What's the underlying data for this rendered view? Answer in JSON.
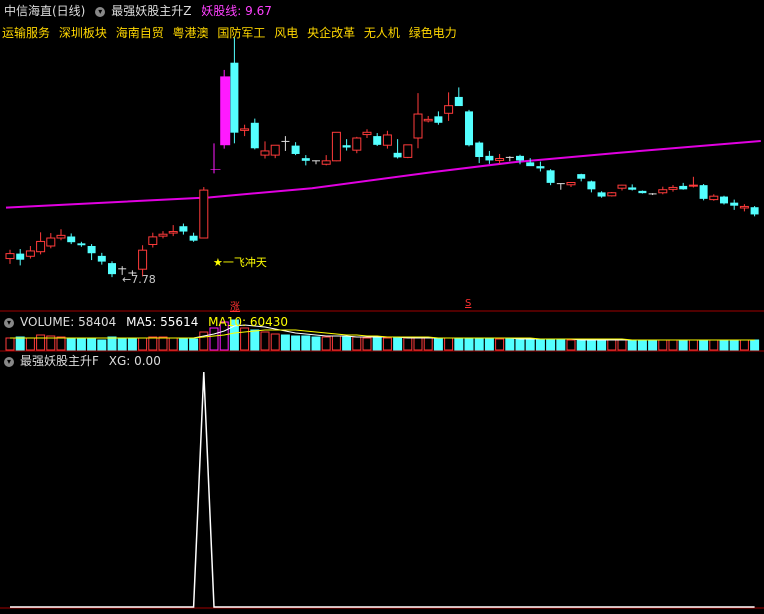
{
  "header": {
    "stock_title": "中信海直(日线)",
    "indicator_name": "最强妖股主升Z",
    "yaogu_label": "妖股线: 9.67"
  },
  "sector_tags": [
    "运输服务",
    "深圳板块",
    "海南自贸",
    "粤港澳",
    "国防军工",
    "风电",
    "央企改革",
    "无人机",
    "绿色电力"
  ],
  "annotations": {
    "low_price": "7.78",
    "signal_text": "一飞冲天",
    "signal_star": "★",
    "badge_zhang": "涨",
    "badge_s": "S"
  },
  "volume_panel": {
    "volume_label": "VOLUME: 58404",
    "ma5_label": "MA5: 55614",
    "ma10_label": "MA10: 60430"
  },
  "xg_panel": {
    "title": "最强妖股主升F",
    "xg_label": "XG: 0.00"
  },
  "colors": {
    "up": "#ff3b3b",
    "down": "#54ffff",
    "signal": "#ff1aff",
    "signal_base": "#ffff00",
    "ma_line": "#e100e1",
    "ma5": "#ffffff",
    "ma10": "#ffff00",
    "tags": "#ffd700"
  },
  "chart_data": {
    "type": "candlestick",
    "price_scale": "price in 0.5-yuan steps",
    "candles": [
      [
        8.49,
        8.62,
        8.72,
        8.35,
        "up"
      ],
      [
        8.62,
        8.46,
        8.74,
        8.31,
        "down"
      ],
      [
        8.55,
        8.69,
        8.82,
        8.49,
        "up"
      ],
      [
        8.67,
        8.94,
        9.18,
        8.6,
        "up"
      ],
      [
        8.82,
        9.03,
        9.16,
        8.76,
        "up"
      ],
      [
        9.03,
        9.1,
        9.26,
        8.97,
        "up"
      ],
      [
        9.07,
        8.92,
        9.15,
        8.87,
        "down"
      ],
      [
        8.89,
        8.84,
        8.93,
        8.8,
        "down"
      ],
      [
        8.82,
        8.63,
        8.87,
        8.45,
        "down"
      ],
      [
        8.56,
        8.41,
        8.64,
        8.33,
        "down"
      ],
      [
        8.37,
        8.08,
        8.42,
        8.0,
        "down"
      ],
      [
        8.22,
        8.22,
        8.29,
        8.06,
        "flat"
      ],
      [
        8.11,
        8.11,
        8.18,
        8.03,
        "flat"
      ],
      [
        8.21,
        8.71,
        8.84,
        8.02,
        "up"
      ],
      [
        8.86,
        9.06,
        9.17,
        8.78,
        "up"
      ],
      [
        9.08,
        9.13,
        9.21,
        9.02,
        "up"
      ],
      [
        9.16,
        9.2,
        9.37,
        9.08,
        "up"
      ],
      [
        9.34,
        9.2,
        9.41,
        9.12,
        "down"
      ],
      [
        9.09,
        8.96,
        9.17,
        8.93,
        "down"
      ],
      [
        9.03,
        10.29,
        10.37,
        9.02,
        "up"
      ],
      [
        10.84,
        10.84,
        11.52,
        10.73,
        "up"
      ],
      [
        11.47,
        13.28,
        13.45,
        11.38,
        "up"
      ],
      [
        13.64,
        11.8,
        14.31,
        11.52,
        "down"
      ],
      [
        11.9,
        11.86,
        12.01,
        11.71,
        "up"
      ],
      [
        12.06,
        11.39,
        12.17,
        11.36,
        "down"
      ],
      [
        11.21,
        11.32,
        11.57,
        11.12,
        "up"
      ],
      [
        11.21,
        11.47,
        11.47,
        11.13,
        "up"
      ],
      [
        11.57,
        11.57,
        11.71,
        11.32,
        "flat"
      ],
      [
        11.46,
        11.24,
        11.55,
        11.21,
        "down"
      ],
      [
        11.13,
        11.06,
        11.21,
        10.94,
        "down"
      ],
      [
        11.06,
        11.05,
        11.07,
        10.97,
        "flat"
      ],
      [
        10.97,
        11.06,
        11.21,
        10.94,
        "up"
      ],
      [
        11.06,
        11.81,
        11.81,
        11.05,
        "up"
      ],
      [
        11.47,
        11.41,
        11.63,
        11.33,
        "down"
      ],
      [
        11.34,
        11.66,
        11.69,
        11.26,
        "up"
      ],
      [
        11.75,
        11.81,
        11.89,
        11.66,
        "up"
      ],
      [
        11.71,
        11.48,
        11.79,
        11.45,
        "down"
      ],
      [
        11.47,
        11.74,
        11.85,
        11.38,
        "up"
      ],
      [
        11.27,
        11.15,
        11.63,
        11.12,
        "down"
      ],
      [
        11.15,
        11.48,
        11.48,
        11.13,
        "up"
      ],
      [
        11.66,
        12.29,
        12.84,
        11.39,
        "up"
      ],
      [
        12.11,
        12.15,
        12.24,
        12.07,
        "up"
      ],
      [
        12.23,
        12.06,
        12.36,
        12.01,
        "down"
      ],
      [
        12.31,
        12.51,
        12.86,
        12.11,
        "up"
      ],
      [
        12.74,
        12.5,
        12.99,
        12.52,
        "down"
      ],
      [
        12.36,
        11.47,
        12.4,
        11.44,
        "down"
      ],
      [
        11.54,
        11.16,
        11.57,
        11.0,
        "down"
      ],
      [
        11.19,
        11.07,
        11.32,
        10.98,
        "down"
      ],
      [
        11.07,
        11.12,
        11.24,
        10.97,
        "up"
      ],
      [
        11.15,
        11.12,
        11.18,
        11.05,
        "flat"
      ],
      [
        11.19,
        11.07,
        11.22,
        10.97,
        "down"
      ],
      [
        11.02,
        10.92,
        11.13,
        10.94,
        "down"
      ],
      [
        10.92,
        10.86,
        11.04,
        10.78,
        "down"
      ],
      [
        10.81,
        10.48,
        10.84,
        10.42,
        "down"
      ],
      [
        10.46,
        10.45,
        10.47,
        10.3,
        "flat"
      ],
      [
        10.43,
        10.49,
        10.49,
        10.37,
        "up"
      ],
      [
        10.71,
        10.59,
        10.72,
        10.52,
        "down"
      ],
      [
        10.52,
        10.31,
        10.54,
        10.23,
        "down"
      ],
      [
        10.23,
        10.12,
        10.26,
        10.09,
        "down"
      ],
      [
        10.14,
        10.22,
        10.24,
        10.12,
        "up"
      ],
      [
        10.34,
        10.42,
        10.43,
        10.28,
        "up"
      ],
      [
        10.36,
        10.3,
        10.44,
        10.28,
        "down"
      ],
      [
        10.27,
        10.21,
        10.28,
        10.2,
        "down"
      ],
      [
        10.19,
        10.18,
        10.21,
        10.16,
        "flat"
      ],
      [
        10.22,
        10.3,
        10.38,
        10.18,
        "up"
      ],
      [
        10.31,
        10.36,
        10.42,
        10.25,
        "up"
      ],
      [
        10.4,
        10.31,
        10.48,
        10.3,
        "down"
      ],
      [
        10.4,
        10.42,
        10.64,
        10.36,
        "up"
      ],
      [
        10.42,
        10.06,
        10.45,
        10.02,
        "down"
      ],
      [
        10.04,
        10.13,
        10.18,
        10.01,
        "up"
      ],
      [
        10.12,
        9.94,
        10.14,
        9.91,
        "down"
      ],
      [
        9.96,
        9.88,
        10.04,
        9.77,
        "down"
      ],
      [
        9.86,
        9.82,
        9.92,
        9.73,
        "up"
      ],
      [
        9.84,
        9.65,
        9.87,
        9.6,
        "down"
      ]
    ],
    "yaogu_line": [
      [
        0,
        9.83
      ],
      [
        20,
        10.1
      ],
      [
        30,
        10.34
      ],
      [
        42,
        10.77
      ],
      [
        50,
        11.03
      ],
      [
        60,
        11.27
      ],
      [
        74,
        11.58
      ]
    ],
    "volume": [
      12,
      13,
      12,
      15,
      14,
      13,
      12,
      11,
      12,
      10,
      13,
      11,
      11,
      12,
      13,
      13,
      12,
      12,
      11,
      18,
      22,
      28,
      30,
      22,
      20,
      18,
      16,
      15,
      14,
      14,
      13,
      13,
      14,
      13,
      13,
      12,
      12,
      12,
      12,
      12,
      13,
      12,
      12,
      12,
      12,
      12,
      12,
      12,
      11,
      11,
      11,
      11,
      11,
      11,
      11,
      10,
      10,
      10,
      10,
      10,
      10,
      10,
      10,
      10,
      10,
      10,
      10,
      10,
      10,
      10,
      10,
      10,
      10,
      10
    ],
    "volume_ma5": [
      12,
      12,
      12,
      12,
      12,
      12,
      12,
      12,
      12,
      12,
      12,
      12,
      12,
      12,
      12,
      12,
      12,
      12,
      12,
      14,
      16,
      19,
      24,
      25,
      24,
      23,
      21,
      19,
      17,
      16,
      15,
      14,
      14,
      14,
      13,
      13,
      13,
      13,
      13,
      12,
      12,
      12,
      12,
      12,
      12,
      12,
      12,
      12,
      12,
      12,
      11,
      11,
      11,
      11,
      11,
      11,
      10,
      10,
      10,
      10,
      10,
      10,
      10,
      10,
      10,
      10,
      10,
      10,
      10,
      10,
      10,
      10,
      10,
      10
    ],
    "volume_ma10": [
      12,
      12,
      12,
      12,
      12,
      12,
      12,
      12,
      12,
      12,
      12,
      12,
      12,
      12,
      12,
      12,
      12,
      12,
      12,
      13,
      14,
      15,
      17,
      18,
      19,
      20,
      20,
      20,
      20,
      19,
      18,
      17,
      16,
      15,
      15,
      14,
      14,
      13,
      13,
      13,
      13,
      13,
      12,
      12,
      12,
      12,
      12,
      12,
      12,
      12,
      12,
      12,
      11,
      11,
      11,
      11,
      11,
      11,
      11,
      11,
      11,
      10,
      10,
      10,
      10,
      10,
      10,
      10,
      10,
      10,
      10,
      10,
      10,
      10
    ],
    "xg": [
      0,
      0,
      0,
      0,
      0,
      0,
      0,
      0,
      0,
      0,
      0,
      0,
      0,
      0,
      0,
      0,
      0,
      0,
      0,
      1,
      0,
      0,
      0,
      0,
      0,
      0,
      0,
      0,
      0,
      0,
      0,
      0,
      0,
      0,
      0,
      0,
      0,
      0,
      0,
      0,
      0,
      0,
      0,
      0,
      0,
      0,
      0,
      0,
      0,
      0,
      0,
      0,
      0,
      0,
      0,
      0,
      0,
      0,
      0,
      0,
      0,
      0,
      0,
      0,
      0,
      0,
      0,
      0,
      0,
      0,
      0,
      0,
      0,
      0
    ]
  }
}
